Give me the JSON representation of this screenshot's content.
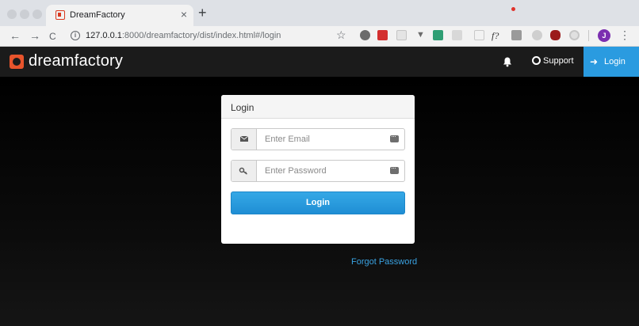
{
  "browser": {
    "tab_title": "DreamFactory",
    "tab_close": "×",
    "new_tab": "+",
    "back": "←",
    "forward": "→",
    "reload": "C",
    "url_host": "127.0.0.1",
    "url_rest": ":8000/dreamfactory/dist/index.html#/login",
    "bookmark_star": "☆",
    "profile_initial": "J",
    "menu": "⋮"
  },
  "navbar": {
    "brand": "dreamfactory",
    "support_label": "Support",
    "login_label": "Login",
    "accent_color": "#2a9be0"
  },
  "login_form": {
    "title": "Login",
    "email_placeholder": "Enter Email",
    "password_placeholder": "Enter Password",
    "submit_label": "Login"
  },
  "forgot_password": "Forgot Password"
}
